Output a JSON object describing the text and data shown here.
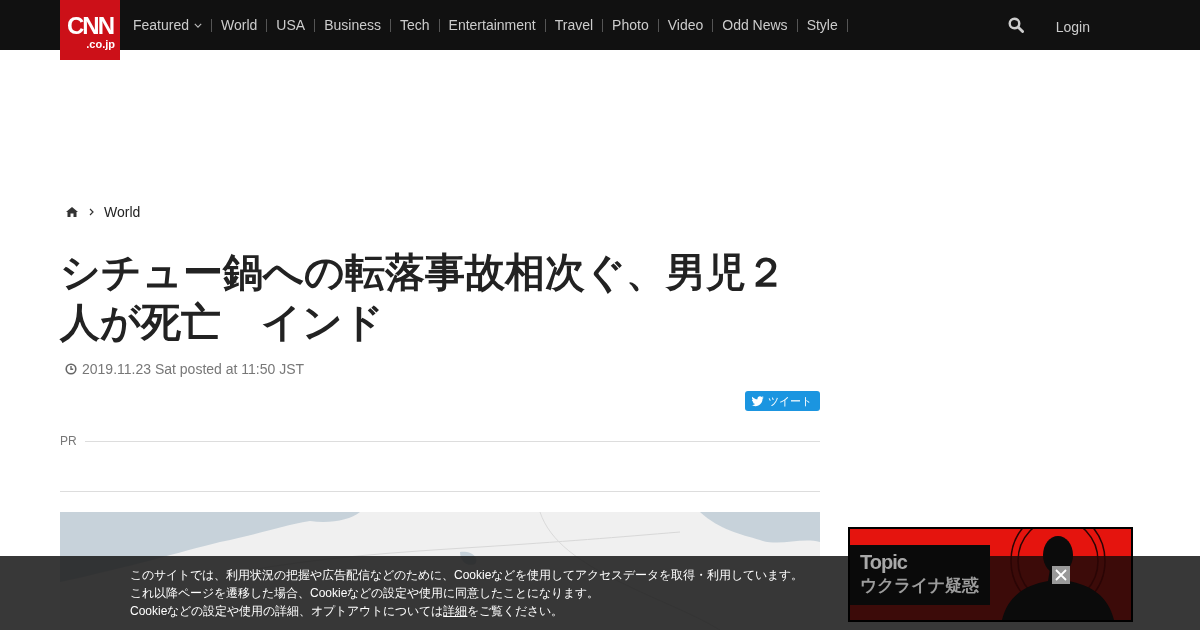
{
  "header": {
    "logo": {
      "name": "CNN",
      "domain": ".co.jp"
    },
    "nav": [
      {
        "label": "Featured",
        "has_menu": true
      },
      {
        "label": "World",
        "has_menu": false
      },
      {
        "label": "USA",
        "has_menu": false
      },
      {
        "label": "Business",
        "has_menu": false
      },
      {
        "label": "Tech",
        "has_menu": false
      },
      {
        "label": "Entertainment",
        "has_menu": false
      },
      {
        "label": "Travel",
        "has_menu": false
      },
      {
        "label": "Photo",
        "has_menu": false
      },
      {
        "label": "Video",
        "has_menu": false
      },
      {
        "label": "Odd News",
        "has_menu": false
      },
      {
        "label": "Style",
        "has_menu": false
      }
    ],
    "login": "Login"
  },
  "breadcrumb": [
    {
      "label": "World"
    }
  ],
  "article": {
    "title": "シチュー鍋への転落事故相次ぐ、男児２人が死亡　インド",
    "posted": "2019.11.23 Sat posted at 11:50 JST",
    "tweet_button": "ツイート",
    "pr_label": "PR"
  },
  "sidebar": {
    "banner": {
      "label": "Topic",
      "title": "ウクライナ疑惑"
    }
  },
  "cookie_notice": {
    "lines": [
      "このサイトでは、利用状況の把握や広告配信などのために、Cookieなどを使用してアクセスデータを取得・利用しています。",
      "これ以降ページを遷移した場合、Cookieなどの設定や使用に同意したことになります。"
    ],
    "last_line": {
      "before": "Cookieなどの設定や使用の詳細、オプトアウトについては",
      "link": "詳細",
      "after": "をご覧ください。"
    }
  }
}
